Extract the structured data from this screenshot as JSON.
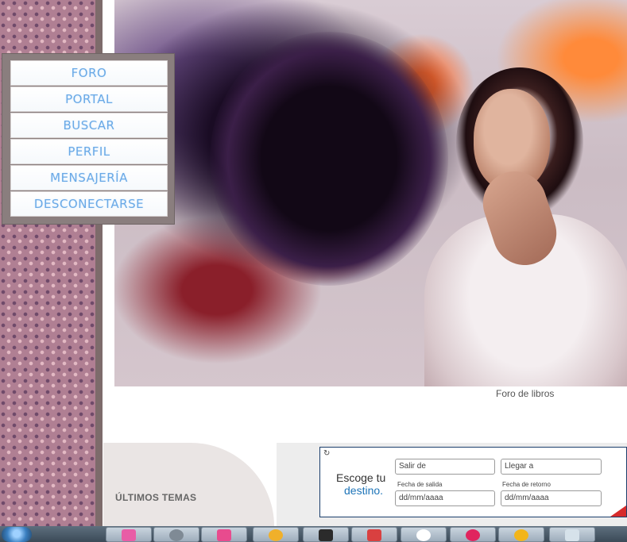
{
  "menu": {
    "items": [
      {
        "label": "FORO"
      },
      {
        "label": "PORTAL"
      },
      {
        "label": "BUSCAR"
      },
      {
        "label": "PERFIL"
      },
      {
        "label": "MENSAJERÍA"
      },
      {
        "label": "DESCONECTARSE"
      }
    ]
  },
  "hero": {
    "caption": "Foro de libros"
  },
  "latest": {
    "title": "ÚLTIMOS TEMAS"
  },
  "widget": {
    "refresh_icon": "↻",
    "line1": "Escoge tu",
    "line2": "destino.",
    "depart_placeholder": "Salir de",
    "arrive_placeholder": "Llegar a",
    "depart_date_label": "Fecha de salida",
    "return_date_label": "Fecha de retorno",
    "depart_date_placeholder": "dd/mm/aaaa",
    "return_date_placeholder": "dd/mm/aaaa"
  },
  "taskbar": {
    "tasks": [
      {
        "icon": "pink-arrow-icon",
        "color": "#e85da6"
      },
      {
        "icon": "wordpress-icon",
        "color": "#7f8a95"
      },
      {
        "icon": "pink-app-icon",
        "color": "#e84b8e"
      },
      {
        "icon": "chrome-icon",
        "color": "#f0b02a"
      },
      {
        "icon": "notebook-icon",
        "color": "#2b2b2b"
      },
      {
        "icon": "game-icon",
        "color": "#d94040"
      },
      {
        "icon": "eyes-icon",
        "color": "#ffffff"
      },
      {
        "icon": "play-icon",
        "color": "#e0245e"
      },
      {
        "icon": "close-circle-icon",
        "color": "#f2b51b"
      },
      {
        "icon": "notepad-icon",
        "color": "#d6e2ea"
      }
    ]
  }
}
